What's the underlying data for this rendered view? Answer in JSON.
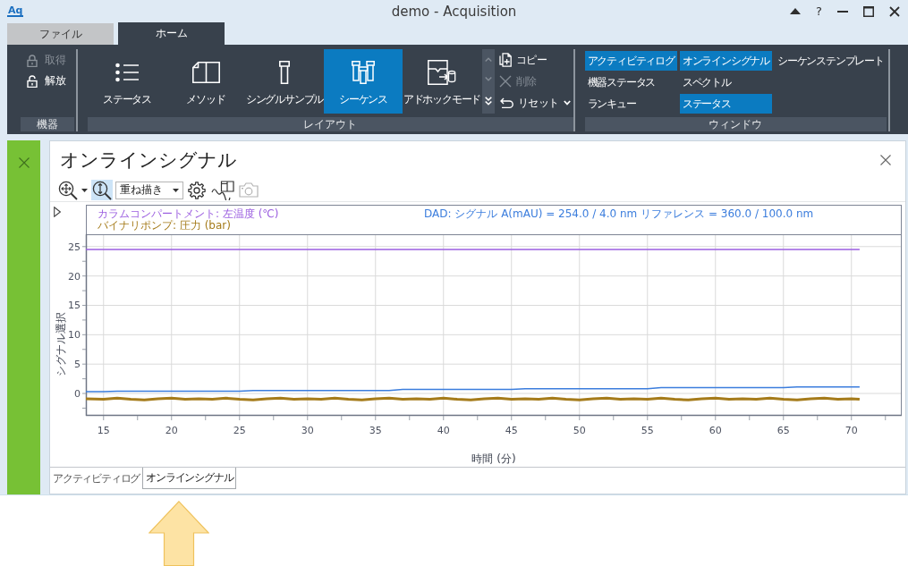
{
  "window": {
    "logo": "Aq",
    "title": "demo - Acquisition",
    "help": "?"
  },
  "ribbon_tabs": [
    {
      "label": "ファイル",
      "selected": false
    },
    {
      "label": "ホーム",
      "selected": true
    }
  ],
  "ribbon": {
    "instrument_group": {
      "label": "機器",
      "items": [
        {
          "label": "取得",
          "kind": "lock",
          "disabled": true
        },
        {
          "label": "解放",
          "kind": "unlock",
          "disabled": false
        }
      ]
    },
    "layout_group": {
      "label": "レイアウト",
      "large_buttons": [
        {
          "label": "ステータス",
          "kind": "list",
          "selected": false
        },
        {
          "label": "メソッド",
          "kind": "method",
          "selected": false
        },
        {
          "label": "シングルサンプル",
          "kind": "vial",
          "selected": false
        },
        {
          "label": "シーケンス",
          "kind": "vials",
          "selected": true
        },
        {
          "label": "アドホックモード",
          "kind": "adhoc",
          "selected": false
        }
      ],
      "gallery_scroll": {
        "up_disabled": true,
        "down_disabled": true
      },
      "small_buttons": [
        {
          "label": "コピー",
          "kind": "copy",
          "disabled": false,
          "has_menu": false
        },
        {
          "label": "削除",
          "kind": "delete",
          "disabled": true,
          "has_menu": false
        },
        {
          "label": "リセット",
          "kind": "reset",
          "disabled": false,
          "has_menu": true
        }
      ]
    },
    "window_group": {
      "label": "ウィンドウ",
      "columns": [
        [
          {
            "label": "アクティビティログ",
            "selected": true
          },
          {
            "label": "機器ステータス",
            "selected": false
          },
          {
            "label": "ランキュー",
            "selected": false
          }
        ],
        [
          {
            "label": "オンラインシグナル",
            "selected": true
          },
          {
            "label": "スペクトル",
            "selected": false
          },
          {
            "label": "ステータス",
            "selected": true
          }
        ],
        [
          {
            "label": "シーケンステンプレート",
            "selected": false
          }
        ]
      ]
    }
  },
  "panel": {
    "title": "オンラインシグナル",
    "toolbar": [
      {
        "kind": "zoom-pan",
        "selected": false,
        "disabled": false,
        "has_menu": true
      },
      {
        "kind": "zoom-vertical",
        "selected": true,
        "disabled": false,
        "has_menu": false
      },
      {
        "kind": "select",
        "value": "重ね描き"
      },
      {
        "kind": "settings",
        "selected": false,
        "disabled": false,
        "has_menu": false
      },
      {
        "kind": "signal-window",
        "selected": false,
        "disabled": false,
        "has_menu": false
      },
      {
        "kind": "camera",
        "selected": false,
        "disabled": true,
        "has_menu": false
      }
    ],
    "chart": {
      "chart_data": {
        "type": "line",
        "xlabel": "時間 (分)",
        "ylabel": "シグナル選択",
        "grid": true,
        "x": [
          13.7,
          15,
          16,
          17,
          18,
          19,
          20,
          21,
          22,
          23,
          24,
          25,
          26,
          27,
          28,
          29,
          30,
          31,
          32,
          33,
          34,
          35,
          36,
          37,
          38,
          39,
          40,
          41,
          42,
          43,
          44,
          45,
          46,
          47,
          48,
          49,
          50,
          51,
          52,
          53,
          54,
          55,
          56,
          57,
          58,
          59,
          60,
          61,
          62,
          63,
          64,
          65,
          66,
          67,
          68,
          69,
          70,
          70.6
        ],
        "series": [
          {
            "name": "カラムコンパートメント: 左温度 (℃)",
            "color": "#9b5ee0",
            "values": [
              24.5,
              24.5,
              24.5,
              24.5,
              24.5,
              24.5,
              24.5,
              24.5,
              24.5,
              24.5,
              24.5,
              24.5,
              24.5,
              24.5,
              24.5,
              24.5,
              24.5,
              24.5,
              24.5,
              24.5,
              24.5,
              24.5,
              24.5,
              24.5,
              24.5,
              24.5,
              24.5,
              24.5,
              24.5,
              24.5,
              24.5,
              24.5,
              24.5,
              24.5,
              24.5,
              24.5,
              24.5,
              24.5,
              24.5,
              24.5,
              24.5,
              24.5,
              24.5,
              24.5,
              24.5,
              24.5,
              24.5,
              24.5,
              24.5,
              24.5,
              24.5,
              24.5,
              24.5,
              24.5,
              24.5,
              24.5,
              24.5,
              24.5
            ]
          },
          {
            "name": "バイナリポンプ: 圧力 (bar)",
            "color": "#a57b1a",
            "values": [
              -0.9,
              -1.0,
              -0.8,
              -1.0,
              -1.1,
              -0.9,
              -0.8,
              -1.0,
              -0.9,
              -1.0,
              -0.8,
              -1.0,
              -1.1,
              -0.9,
              -0.8,
              -1.0,
              -0.9,
              -1.0,
              -0.8,
              -1.0,
              -1.1,
              -0.9,
              -0.8,
              -1.0,
              -0.9,
              -1.0,
              -0.8,
              -1.0,
              -1.1,
              -0.9,
              -0.8,
              -1.0,
              -0.9,
              -1.0,
              -0.8,
              -1.0,
              -1.1,
              -0.9,
              -0.8,
              -1.0,
              -0.9,
              -1.0,
              -0.8,
              -1.0,
              -1.1,
              -0.9,
              -0.8,
              -1.0,
              -0.9,
              -1.0,
              -0.8,
              -1.0,
              -1.1,
              -0.9,
              -0.8,
              -1.0,
              -0.9,
              -1.0
            ]
          },
          {
            "name": "DAD: シグナル A(mAU) = 254.0 / 4.0 nm リファレンス = 360.0 / 100.0 nm",
            "color": "#3b7ddd",
            "values": [
              0.3,
              0.3,
              0.4,
              0.4,
              0.4,
              0.4,
              0.4,
              0.4,
              0.4,
              0.4,
              0.4,
              0.4,
              0.5,
              0.5,
              0.5,
              0.5,
              0.5,
              0.5,
              0.5,
              0.5,
              0.5,
              0.5,
              0.5,
              0.7,
              0.7,
              0.7,
              0.7,
              0.7,
              0.7,
              0.7,
              0.7,
              0.7,
              0.8,
              0.8,
              0.8,
              0.8,
              0.8,
              0.8,
              0.8,
              0.8,
              0.8,
              0.8,
              1.0,
              1.0,
              1.0,
              1.0,
              1.0,
              1.0,
              1.0,
              1.0,
              1.0,
              1.0,
              1.1,
              1.1,
              1.1,
              1.1,
              1.1,
              1.1
            ]
          }
        ],
        "xlim": [
          13.7,
          73.7
        ],
        "ylim": [
          -3.8,
          27.1
        ],
        "xticks": [
          15,
          20,
          25,
          30,
          35,
          40,
          45,
          50,
          55,
          60,
          65,
          70
        ],
        "yticks": [
          0,
          5,
          10,
          15,
          20,
          25
        ]
      }
    },
    "tabs": [
      {
        "label": "アクティビティログ",
        "selected": false
      },
      {
        "label": "オンラインシグナル",
        "selected": true
      }
    ]
  }
}
